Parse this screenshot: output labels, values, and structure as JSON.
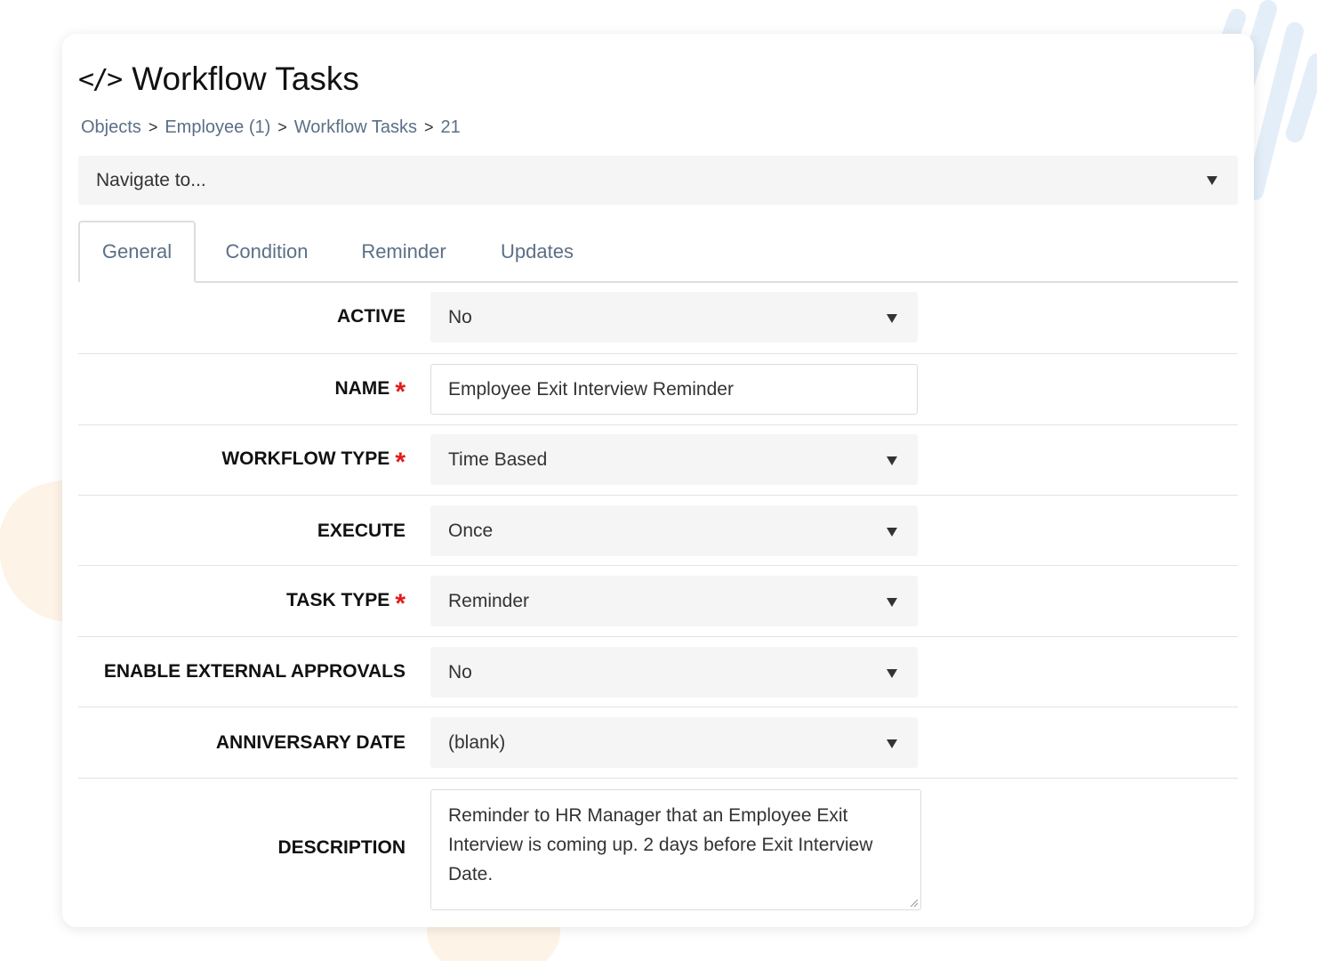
{
  "header": {
    "icon": "code-icon",
    "icon_glyph": "</>",
    "title": "Workflow Tasks"
  },
  "breadcrumb": {
    "items": [
      "Objects",
      "Employee (1)",
      "Workflow Tasks",
      "21"
    ],
    "separator": ">"
  },
  "navigate": {
    "value": "Navigate to..."
  },
  "tabs": [
    {
      "label": "General",
      "active": true
    },
    {
      "label": "Condition",
      "active": false
    },
    {
      "label": "Reminder",
      "active": false
    },
    {
      "label": "Updates",
      "active": false
    }
  ],
  "form": {
    "active": {
      "label": "ACTIVE",
      "value": "No",
      "required": false
    },
    "name": {
      "label": "NAME",
      "value": "Employee Exit Interview Reminder",
      "required": true
    },
    "workflow_type": {
      "label": "WORKFLOW TYPE",
      "value": "Time Based",
      "required": true
    },
    "execute": {
      "label": "EXECUTE",
      "value": "Once",
      "required": false
    },
    "task_type": {
      "label": "TASK TYPE",
      "value": "Reminder",
      "required": true
    },
    "external_approvals": {
      "label": "ENABLE EXTERNAL APPROVALS",
      "value": "No",
      "required": false
    },
    "anniversary_date": {
      "label": "ANNIVERSARY DATE",
      "value": "(blank)",
      "required": false
    },
    "description": {
      "label": "DESCRIPTION",
      "value": "Reminder to HR Manager that an Employee Exit Interview is coming up. 2 days before Exit Interview Date.",
      "required": false
    }
  },
  "required_marker": "*",
  "colors": {
    "required": "#e21b1b",
    "link": "#5b6f86",
    "field_bg": "#f5f5f5"
  }
}
